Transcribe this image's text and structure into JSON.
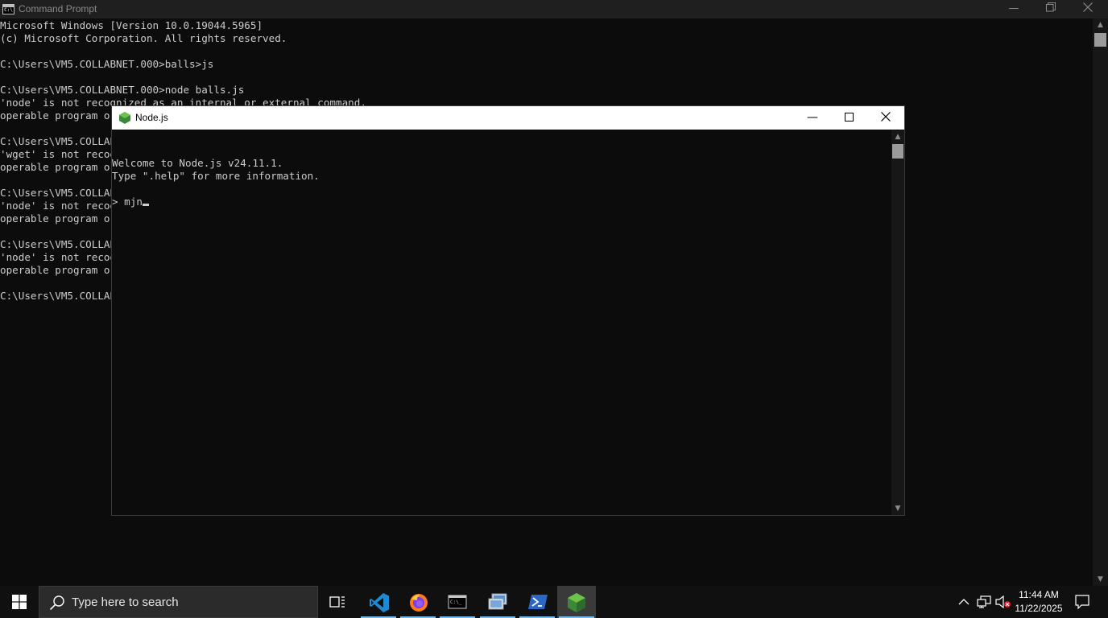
{
  "cmd": {
    "title": "Command Prompt",
    "lines": [
      "Microsoft Windows [Version 10.0.19044.5965]",
      "(c) Microsoft Corporation. All rights reserved.",
      "",
      "C:\\Users\\VM5.COLLABNET.000>balls>js",
      "",
      "C:\\Users\\VM5.COLLABNET.000>node balls.js",
      "'node' is not recognized as an internal or external command,",
      "operable program or batch file.",
      "",
      "C:\\Users\\VM5.COLLABNET.000>wget",
      "'wget' is not recognized as an internal or external command,",
      "operable program or batch file.",
      "",
      "C:\\Users\\VM5.COLLABNET.000>node",
      "'node' is not recognized as an internal or external command,",
      "operable program or batch file.",
      "",
      "C:\\Users\\VM5.COLLABNET.000>node",
      "'node' is not recognized as an internal or external command,",
      "operable program or batch file.",
      "",
      "C:\\Users\\VM5.COLLABNET.000>"
    ]
  },
  "node": {
    "title": "Node.js",
    "lines": [
      "Welcome to Node.js v24.11.1.",
      "Type \".help\" for more information."
    ],
    "prompt": "> ",
    "input": "mjn"
  },
  "taskbar": {
    "search_placeholder": "Type here to search",
    "apps": [
      {
        "name": "task-view-icon"
      },
      {
        "name": "vscode-icon"
      },
      {
        "name": "firefox-icon"
      },
      {
        "name": "command-prompt-icon"
      },
      {
        "name": "remote-desktop-icon"
      },
      {
        "name": "powershell-icon"
      },
      {
        "name": "nodejs-icon",
        "active": true
      }
    ],
    "time": "11:44 AM",
    "date": "11/22/2025"
  },
  "colors": {
    "console_bg": "#0c0c0c",
    "console_text": "#cccccc",
    "taskbar_bg": "#101010",
    "accent": "#76b9ed",
    "node_green": "#3c873a"
  }
}
